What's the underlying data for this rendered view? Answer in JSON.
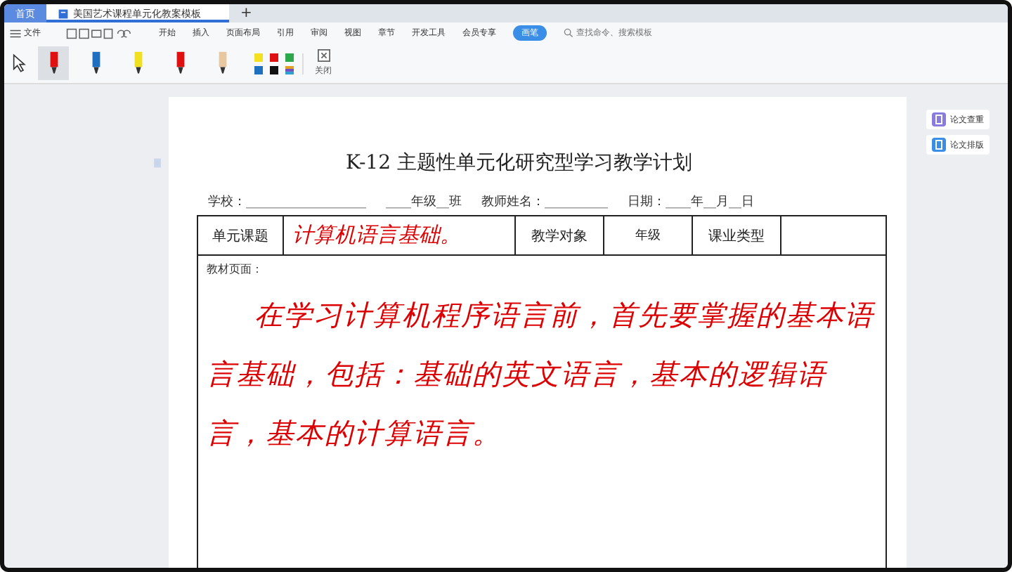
{
  "tabs": [
    {
      "label": "首页",
      "selected": false,
      "kind": "home"
    },
    {
      "label": "美国艺术课程单元化教案模板",
      "selected": true,
      "kind": "doc"
    }
  ],
  "new_tab": "+",
  "menu": {
    "file": "文件",
    "items": [
      {
        "label": "开始"
      },
      {
        "label": "插入"
      },
      {
        "label": "页面布局"
      },
      {
        "label": "引用"
      },
      {
        "label": "审阅"
      },
      {
        "label": "视图"
      },
      {
        "label": "章节"
      },
      {
        "label": "开发工具"
      },
      {
        "label": "会员专享"
      }
    ],
    "active_item": "画笔",
    "search": {
      "placeholder": "查找命令、搜索模板"
    }
  },
  "pens": [
    {
      "color": "#e01010",
      "selected": true
    },
    {
      "color": "#1e6fc0",
      "selected": false
    },
    {
      "color": "#f0e020",
      "selected": false
    },
    {
      "color": "#e01010",
      "selected": false
    },
    {
      "color": "#e8c8a0",
      "selected": false
    }
  ],
  "swatches": [
    {
      "color": "#f5e020"
    },
    {
      "color": "#e01010"
    },
    {
      "color": "#2aa84a"
    },
    {
      "color": "#1e6fc0"
    },
    {
      "color": "#111111"
    }
  ],
  "close_label": "关闭",
  "document": {
    "title": "K-12 主题性单元化研究型学习教学计划",
    "info": [
      "学校：___________________",
      "____年级__班",
      "教师姓名：__________",
      "日期：____年__月__日"
    ],
    "row": [
      {
        "text": "单元课题",
        "kind": "label"
      },
      {
        "text": "计算机语言基础。",
        "kind": "ink"
      },
      {
        "text": "教学对象",
        "kind": "label"
      },
      {
        "text": "年级",
        "kind": "small"
      },
      {
        "text": "课业类型",
        "kind": "label"
      }
    ],
    "material_label": "教材页面：",
    "handwriting": "在学习计算机程序语言前，首先要掌握的基本语言基础，包括：基础的英文语言，基本的逻辑语言，基本的计算语言。"
  },
  "side_tools": [
    {
      "label": "论文查重"
    },
    {
      "label": "论文排版"
    }
  ]
}
